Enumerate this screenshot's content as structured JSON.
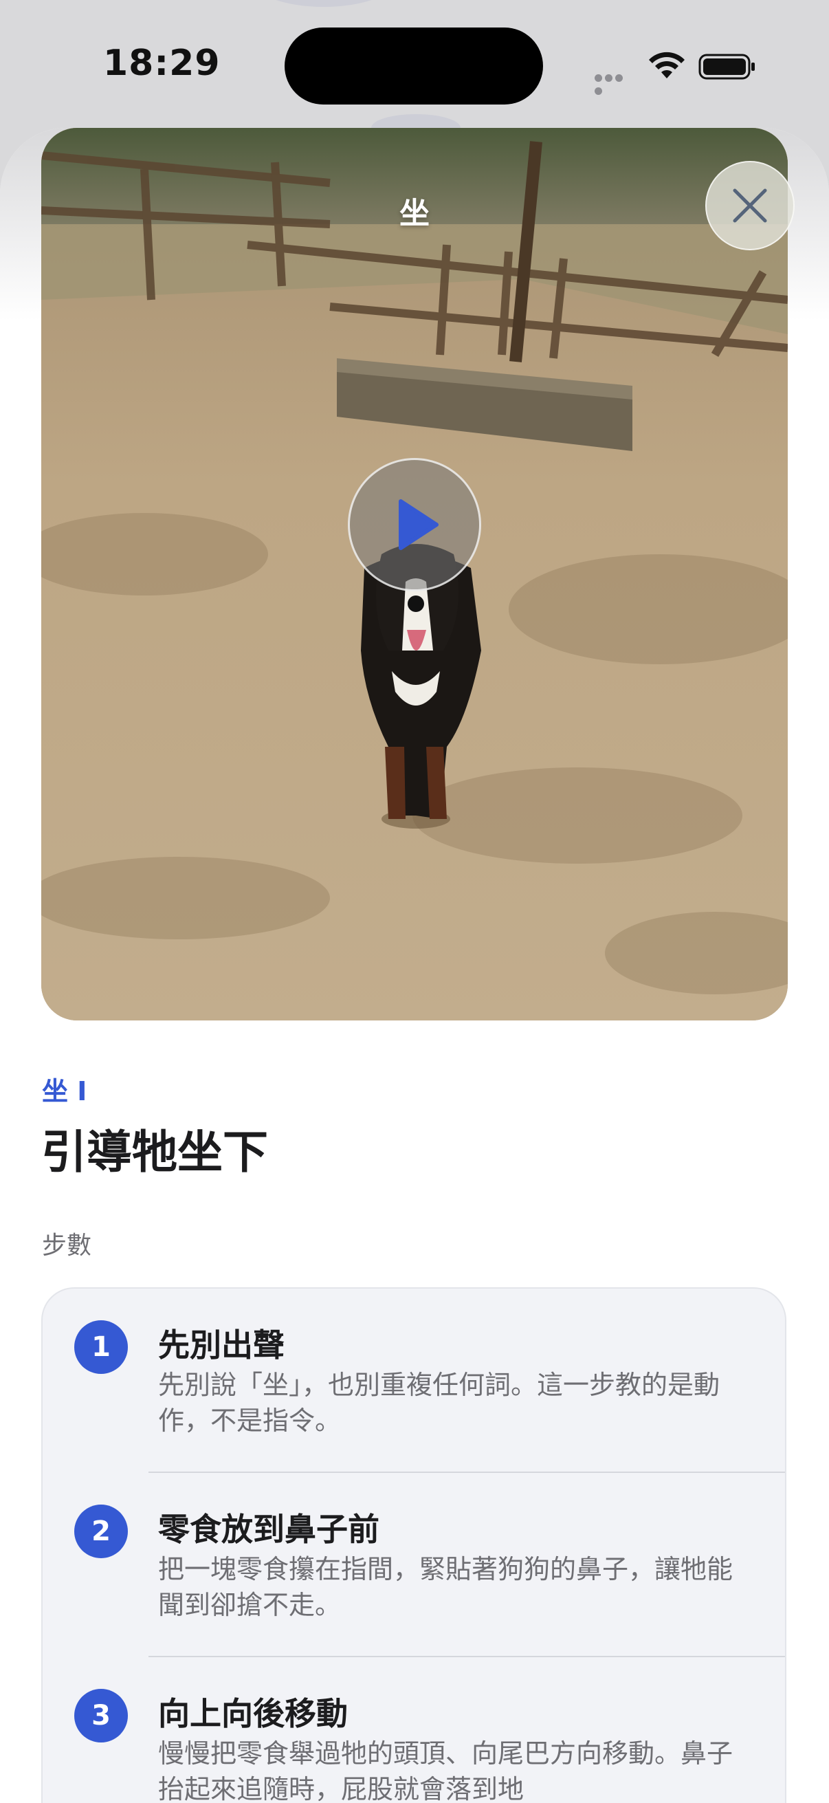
{
  "status_bar": {
    "time": "18:29"
  },
  "video": {
    "title": "坐",
    "close_icon": "close-icon",
    "play_icon": "play-icon"
  },
  "lesson": {
    "overline": "坐 I",
    "title": "引導牠坐下",
    "steps_label": "步數",
    "steps": [
      {
        "number": "1",
        "title": "先別出聲",
        "description": "先別說「坐」，也別重複任何詞。這一步教的是動作，不是指令。"
      },
      {
        "number": "2",
        "title": "零食放到鼻子前",
        "description": "把一塊零食攥在指間，緊貼著狗狗的鼻子，讓牠能聞到卻搶不走。"
      },
      {
        "number": "3",
        "title": "向上向後移動",
        "description": "慢慢把零食舉過牠的頭頂、向尾巴方向移動。鼻子抬起來追隨時，屁股就會落到地"
      }
    ]
  },
  "colors": {
    "accent": "#3559d3",
    "card_background": "#f2f3f7",
    "title_text": "#1c1c1e",
    "secondary_text": "#6e6e73"
  }
}
